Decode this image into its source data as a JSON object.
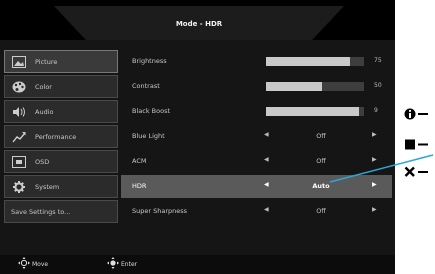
{
  "title": "Mode - HDR",
  "sidebar": {
    "items": [
      {
        "label": "Picture",
        "icon": "picture-icon"
      },
      {
        "label": "Color",
        "icon": "palette-icon"
      },
      {
        "label": "Audio",
        "icon": "speaker-icon"
      },
      {
        "label": "Performance",
        "icon": "performance-icon"
      },
      {
        "label": "OSD",
        "icon": "osd-icon"
      },
      {
        "label": "System",
        "icon": "gear-icon"
      },
      {
        "label": "Save Settings to..."
      }
    ]
  },
  "settings": {
    "brightness": {
      "label": "Brightness",
      "value": "75",
      "level": 0.75
    },
    "contrast": {
      "label": "Contrast",
      "value": "50",
      "level": 0.5
    },
    "black_boost": {
      "label": "Black Boost",
      "value": "9",
      "level": 0.9
    },
    "blue_light": {
      "label": "Blue Light",
      "value": "Off"
    },
    "acm": {
      "label": "ACM",
      "value": "Off"
    },
    "hdr": {
      "label": "HDR",
      "value": "Auto"
    },
    "super_sharpness": {
      "label": "Super Sharpness",
      "value": "Off"
    }
  },
  "footer": {
    "move_label": "Move",
    "enter_label": "Enter"
  },
  "colors": {
    "callout_line": "#2aa7d6",
    "selected_row": "#5a5a5a",
    "background": "#151515"
  }
}
